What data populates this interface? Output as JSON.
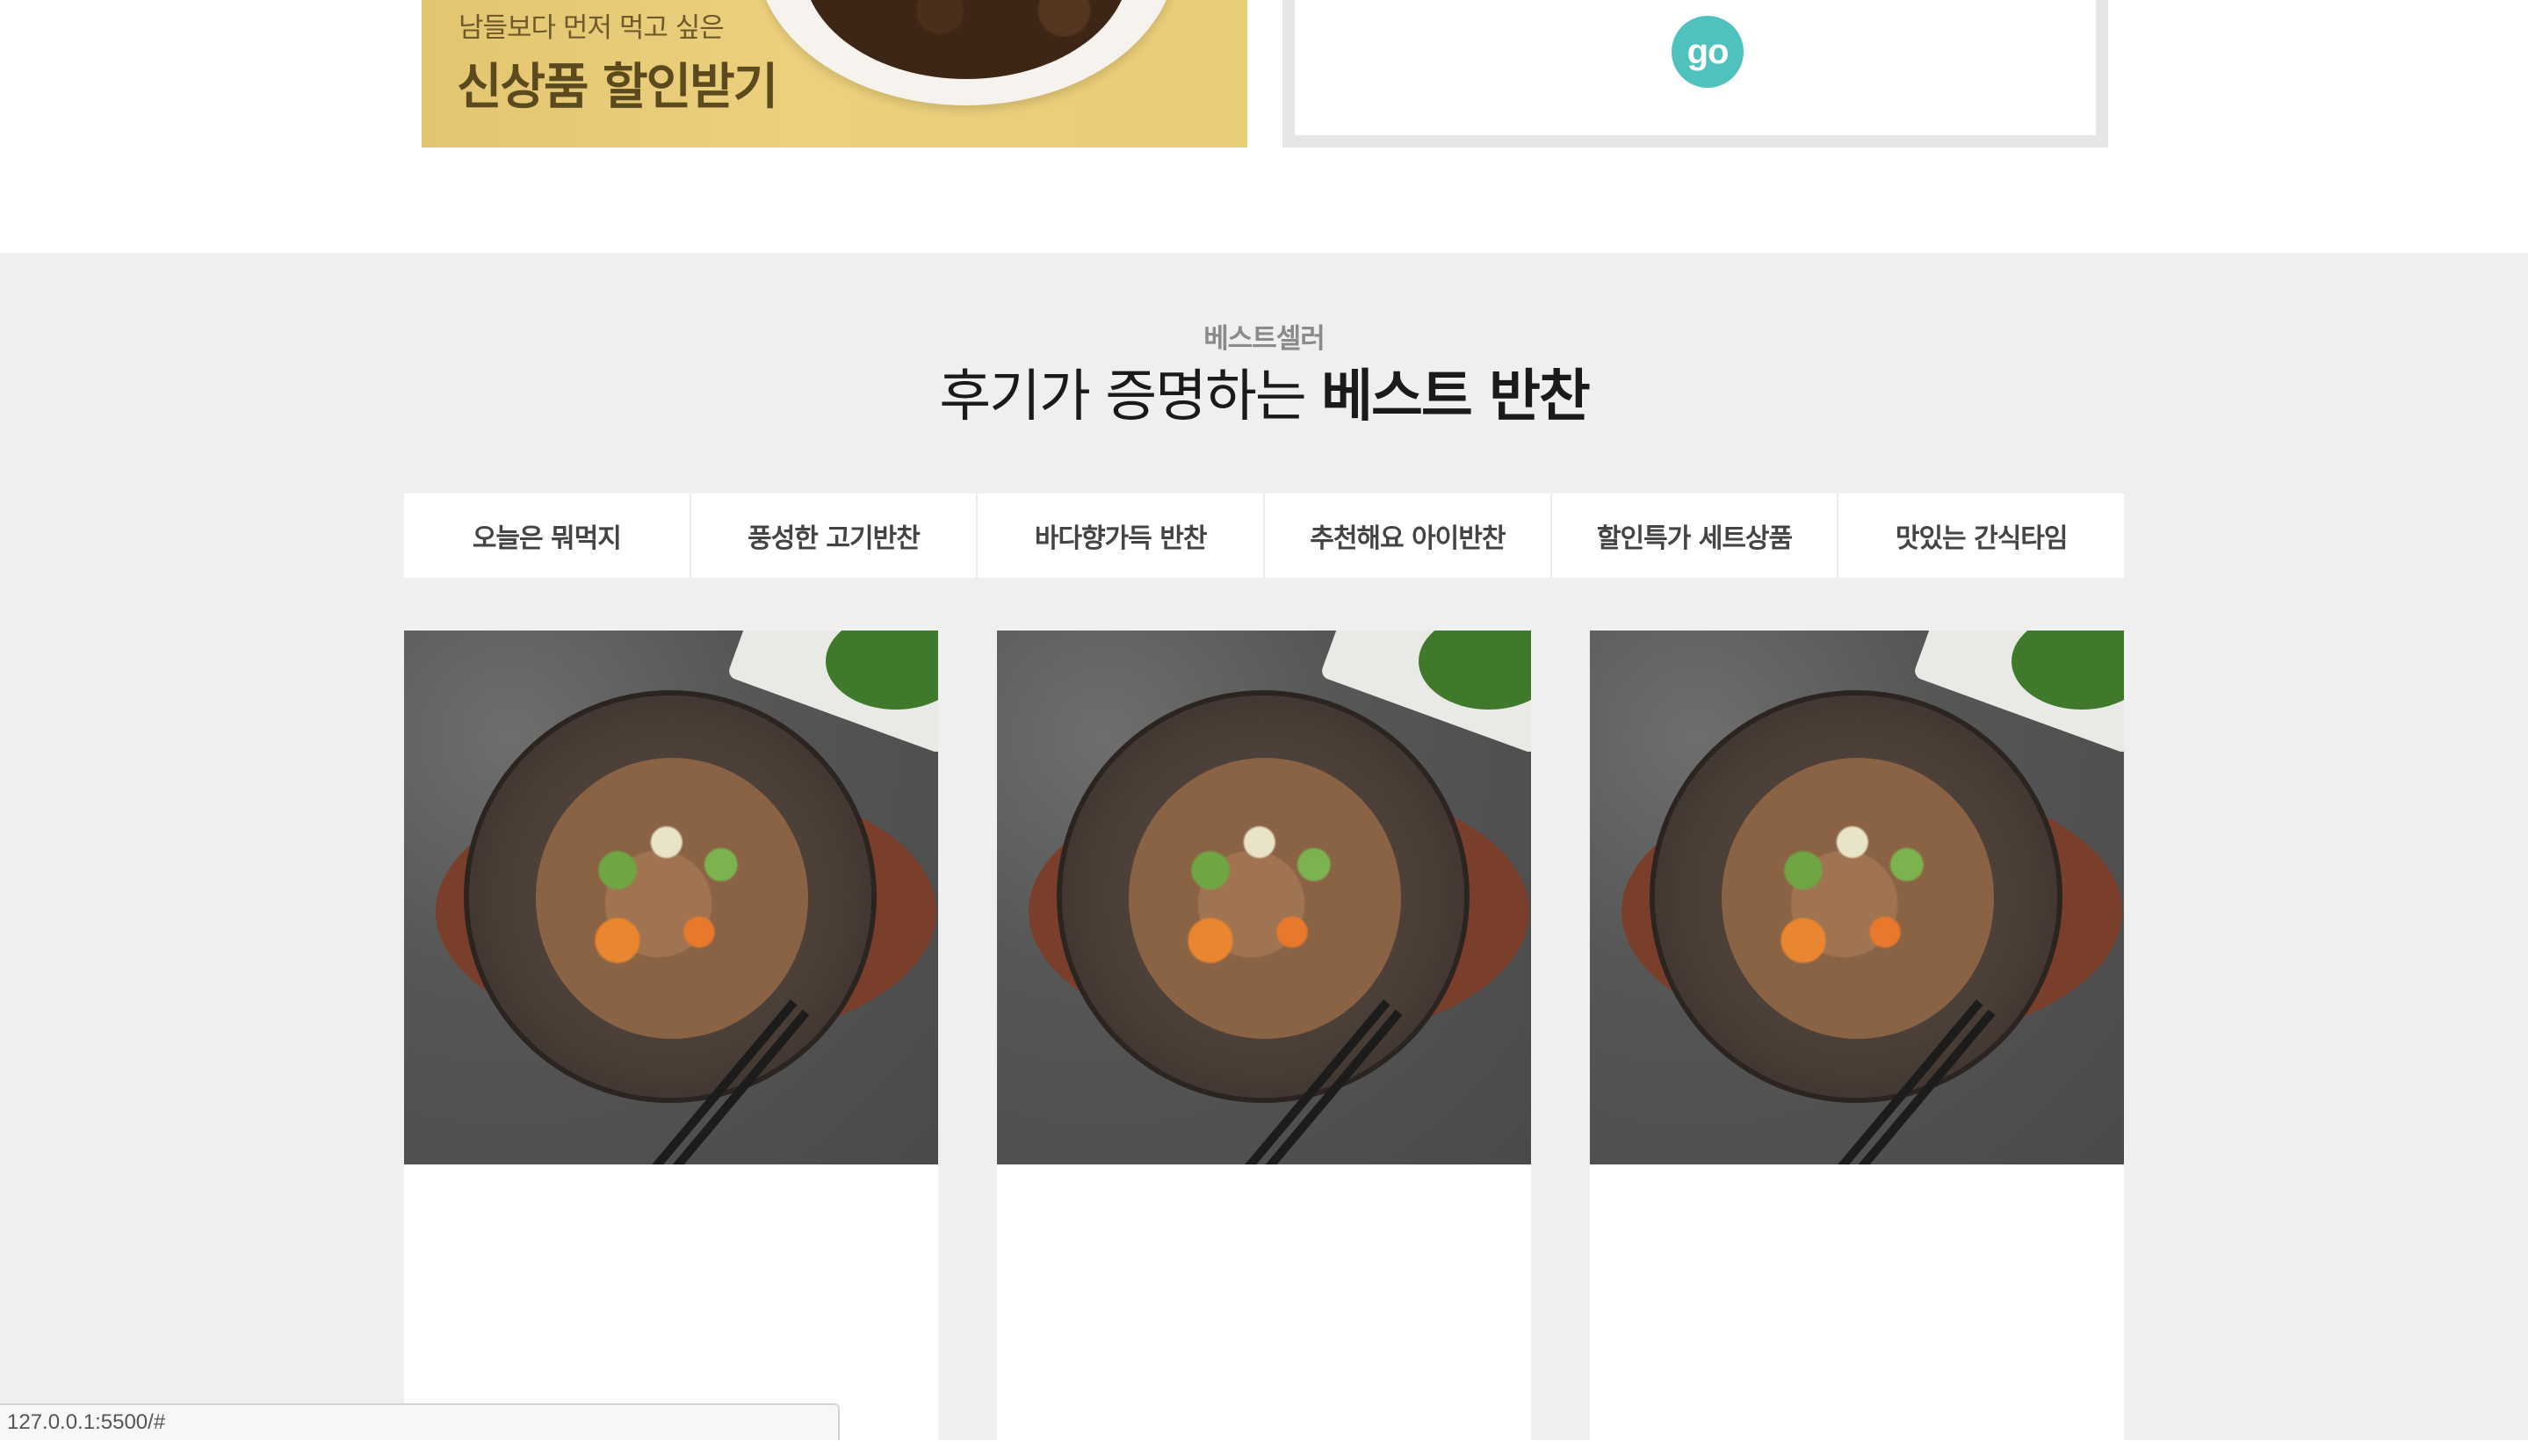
{
  "promo": {
    "subtitle": "남들보다 먼저 먹고 싶은",
    "title": "신상품 할인받기",
    "go_label": "go"
  },
  "bestseller": {
    "eyebrow": "베스트셀러",
    "title_regular": "후기가 증명하는 ",
    "title_bold": "베스트 반찬",
    "tabs": [
      {
        "label": "오늘은 뭐먹지"
      },
      {
        "label": "풍성한 고기반찬"
      },
      {
        "label": "바다향가득 반찬"
      },
      {
        "label": "추천해요 아이반찬"
      },
      {
        "label": "할인특가 세트상품"
      },
      {
        "label": "맛있는 간식타임"
      }
    ]
  },
  "status_bar": {
    "url": "127.0.0.1:5500/#"
  },
  "colors": {
    "go_button": "#4fc2bd",
    "section_bg": "#efefef",
    "promo_bg": "#ecd07e"
  }
}
